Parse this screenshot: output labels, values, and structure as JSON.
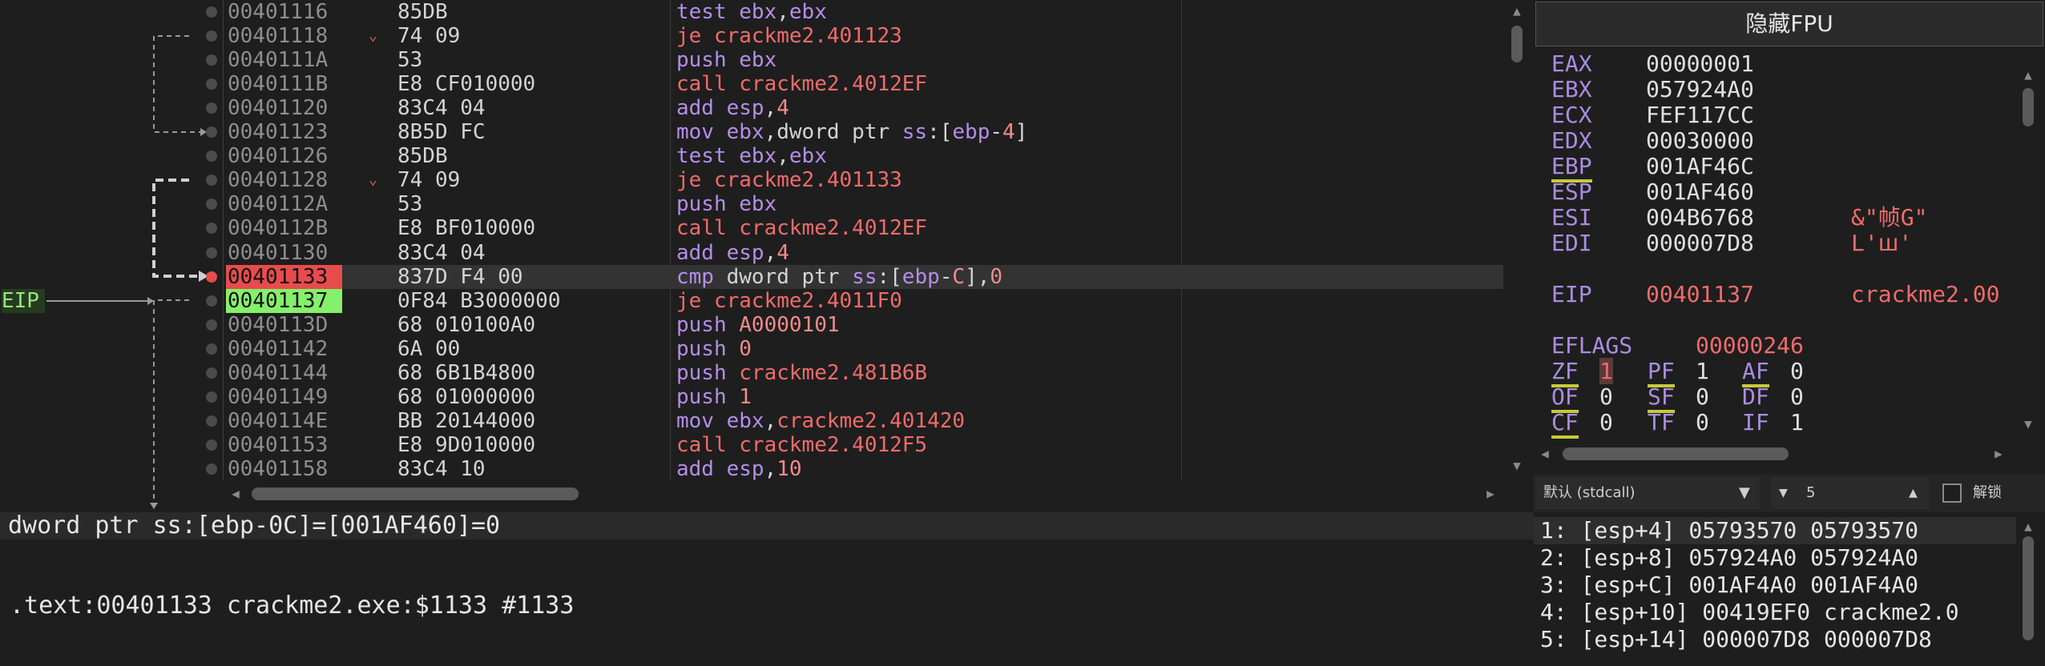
{
  "disassembly": {
    "rows": [
      {
        "addr": "00401116",
        "bytes": "85DB",
        "mn": "test",
        "ops": [
          [
            "reg",
            "ebx"
          ],
          [
            "plain",
            ","
          ],
          [
            "reg",
            "ebx"
          ]
        ]
      },
      {
        "addr": "00401118",
        "bytes": "74 09",
        "mn": "je",
        "fold": true,
        "ops": [
          [
            "target",
            "crackme2.401123"
          ]
        ]
      },
      {
        "addr": "0040111A",
        "bytes": "53",
        "mn": "push",
        "ops": [
          [
            "reg",
            "ebx"
          ]
        ]
      },
      {
        "addr": "0040111B",
        "bytes": "E8 CF010000",
        "mn": "call",
        "ops": [
          [
            "target",
            "crackme2.4012EF"
          ]
        ]
      },
      {
        "addr": "00401120",
        "bytes": "83C4 04",
        "mn": "add",
        "ops": [
          [
            "reg",
            "esp"
          ],
          [
            "plain",
            ","
          ],
          [
            "num",
            "4"
          ]
        ]
      },
      {
        "addr": "00401123",
        "bytes": "8B5D FC",
        "mn": "mov",
        "ops": [
          [
            "reg",
            "ebx"
          ],
          [
            "plain",
            ",dword ptr "
          ],
          [
            "seg",
            "ss"
          ],
          [
            "plain",
            ":["
          ],
          [
            "reg",
            "ebp"
          ],
          [
            "plain",
            "-"
          ],
          [
            "num",
            "4"
          ],
          [
            "plain",
            "]"
          ]
        ]
      },
      {
        "addr": "00401126",
        "bytes": "85DB",
        "mn": "test",
        "ops": [
          [
            "reg",
            "ebx"
          ],
          [
            "plain",
            ","
          ],
          [
            "reg",
            "ebx"
          ]
        ]
      },
      {
        "addr": "00401128",
        "bytes": "74 09",
        "mn": "je",
        "fold": true,
        "ops": [
          [
            "target",
            "crackme2.401133"
          ]
        ]
      },
      {
        "addr": "0040112A",
        "bytes": "53",
        "mn": "push",
        "ops": [
          [
            "reg",
            "ebx"
          ]
        ]
      },
      {
        "addr": "0040112B",
        "bytes": "E8 BF010000",
        "mn": "call",
        "ops": [
          [
            "target",
            "crackme2.4012EF"
          ]
        ]
      },
      {
        "addr": "00401130",
        "bytes": "83C4 04",
        "mn": "add",
        "ops": [
          [
            "reg",
            "esp"
          ],
          [
            "plain",
            ","
          ],
          [
            "num",
            "4"
          ]
        ]
      },
      {
        "addr": "00401133",
        "bytes": "837D F4 00",
        "mn": "cmp",
        "state": "breakpoint",
        "ops": [
          [
            "plain",
            "dword ptr "
          ],
          [
            "seg",
            "ss"
          ],
          [
            "plain",
            ":["
          ],
          [
            "reg",
            "ebp"
          ],
          [
            "plain",
            "-"
          ],
          [
            "num",
            "C"
          ],
          [
            "plain",
            "],"
          ],
          [
            "num",
            "0"
          ]
        ]
      },
      {
        "addr": "00401137",
        "bytes": "0F84 B3000000",
        "mn": "je",
        "state": "eip",
        "ops": [
          [
            "target",
            "crackme2.4011F0"
          ]
        ]
      },
      {
        "addr": "0040113D",
        "bytes": "68 010100A0",
        "mn": "push",
        "ops": [
          [
            "num",
            "A0000101"
          ]
        ]
      },
      {
        "addr": "00401142",
        "bytes": "6A 00",
        "mn": "push",
        "ops": [
          [
            "num",
            "0"
          ]
        ]
      },
      {
        "addr": "00401144",
        "bytes": "68 6B1B4800",
        "mn": "push",
        "ops": [
          [
            "target",
            "crackme2.481B6B"
          ]
        ]
      },
      {
        "addr": "00401149",
        "bytes": "68 01000000",
        "mn": "push",
        "ops": [
          [
            "num",
            "1"
          ]
        ]
      },
      {
        "addr": "0040114E",
        "bytes": "BB 20144000",
        "mn": "mov",
        "ops": [
          [
            "reg",
            "ebx"
          ],
          [
            "plain",
            ","
          ],
          [
            "target",
            "crackme2.401420"
          ]
        ]
      },
      {
        "addr": "00401153",
        "bytes": "E8 9D010000",
        "mn": "call",
        "ops": [
          [
            "target",
            "crackme2.4012F5"
          ]
        ]
      },
      {
        "addr": "00401158",
        "bytes": "83C4 10",
        "mn": "add",
        "ops": [
          [
            "reg",
            "esp"
          ],
          [
            "plain",
            ","
          ],
          [
            "num",
            "10"
          ]
        ]
      }
    ],
    "eip_label": "EIP"
  },
  "info": {
    "line1": "dword ptr ss:[ebp-0C]=[001AF460]=0",
    "line2": ".text:00401133 crackme2.exe:$1133 #1133"
  },
  "registers": {
    "fpu_button": "隐藏FPU",
    "gp": [
      {
        "name": "EAX",
        "value": "00000001",
        "ext": ""
      },
      {
        "name": "EBX",
        "value": "057924A0",
        "ext": ""
      },
      {
        "name": "ECX",
        "value": "FEF117CC",
        "ext": ""
      },
      {
        "name": "EDX",
        "value": "00030000",
        "ext": ""
      },
      {
        "name": "EBP",
        "value": "001AF46C",
        "ext": "",
        "underline": true
      },
      {
        "name": "ESP",
        "value": "001AF460",
        "ext": ""
      },
      {
        "name": "ESI",
        "value": "004B6768",
        "ext": "&\"帧G\""
      },
      {
        "name": "EDI",
        "value": "000007D8",
        "ext": "L'ꟺ'"
      }
    ],
    "eip": {
      "name": "EIP",
      "value": "00401137",
      "ext": "crackme2.00"
    },
    "eflags": {
      "name": "EFLAGS",
      "value": "00000246"
    },
    "flags": [
      [
        {
          "name": "ZF",
          "value": "1",
          "ul": true,
          "hi": true
        },
        {
          "name": "PF",
          "value": "1",
          "ul": true
        },
        {
          "name": "AF",
          "value": "0",
          "ul": true
        }
      ],
      [
        {
          "name": "OF",
          "value": "0",
          "ul": true
        },
        {
          "name": "SF",
          "value": "0",
          "ul": true
        },
        {
          "name": "DF",
          "value": "0"
        }
      ],
      [
        {
          "name": "CF",
          "value": "0",
          "ul": true
        },
        {
          "name": "TF",
          "value": "0"
        },
        {
          "name": "IF",
          "value": "1"
        }
      ]
    ]
  },
  "stack": {
    "calling_convention": "默认 (stdcall)",
    "arg_count": "5",
    "unlock_label": "解锁",
    "rows": [
      "1: [esp+4] 05793570 05793570",
      "2: [esp+8] 057924A0 057924A0",
      "3: [esp+C] 001AF4A0 001AF4A0",
      "4: [esp+10] 00419EF0 crackme2.0",
      "5: [esp+14] 000007D8 000007D8"
    ]
  }
}
